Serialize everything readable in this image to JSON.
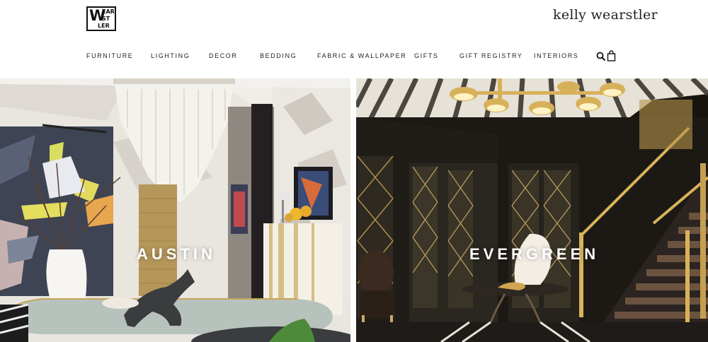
{
  "brand": {
    "logo_letters": [
      "W",
      "EAR",
      "ST",
      "LER"
    ],
    "wordmark": "kelly wearstler"
  },
  "nav": {
    "items": [
      {
        "label": "FURNITURE",
        "id": "furniture"
      },
      {
        "label": "LIGHTING",
        "id": "lighting"
      },
      {
        "label": "DECOR",
        "id": "decor"
      },
      {
        "label": "BEDDING",
        "id": "bedding"
      },
      {
        "label": "FABRIC & WALLPAPER",
        "id": "fabric-wallpaper"
      },
      {
        "label": "GIFTS",
        "id": "gifts"
      },
      {
        "label": "GIFT REGISTRY",
        "id": "gift-registry"
      },
      {
        "label": "INTERIORS",
        "id": "interiors"
      }
    ],
    "search_icon": "search-icon",
    "bag_icon": "shopping-bag-icon"
  },
  "panels": [
    {
      "title": "AUSTIN",
      "image": "austin interior"
    },
    {
      "title": "EVERGREEN",
      "image": "evergreen interior"
    }
  ]
}
